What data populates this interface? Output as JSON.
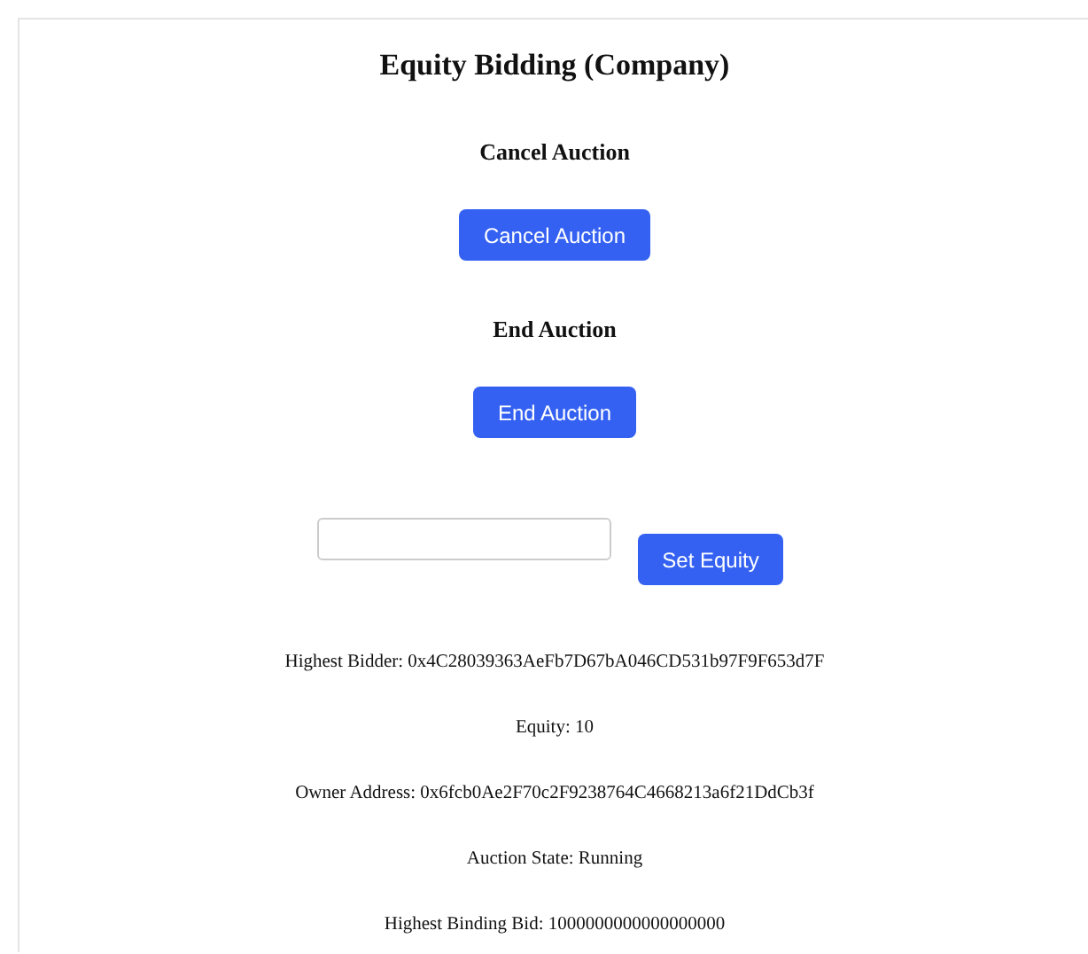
{
  "title": "Equity Bidding (Company)",
  "sections": [
    {
      "heading": "Cancel Auction",
      "button": "Cancel Auction"
    },
    {
      "heading": "End Auction",
      "button": "End Auction"
    }
  ],
  "equity_form": {
    "button": "Set Equity"
  },
  "details": [
    "Highest Bidder: 0x4C28039363AeFb7D67bA046CD531b97F9F653d7F",
    "Equity: 10",
    "Owner Address: 0x6fcb0Ae2F70c2F9238764C4668213a6f21DdCb3f",
    "Auction State: Running",
    "Highest Binding Bid: 1000000000000000000"
  ]
}
